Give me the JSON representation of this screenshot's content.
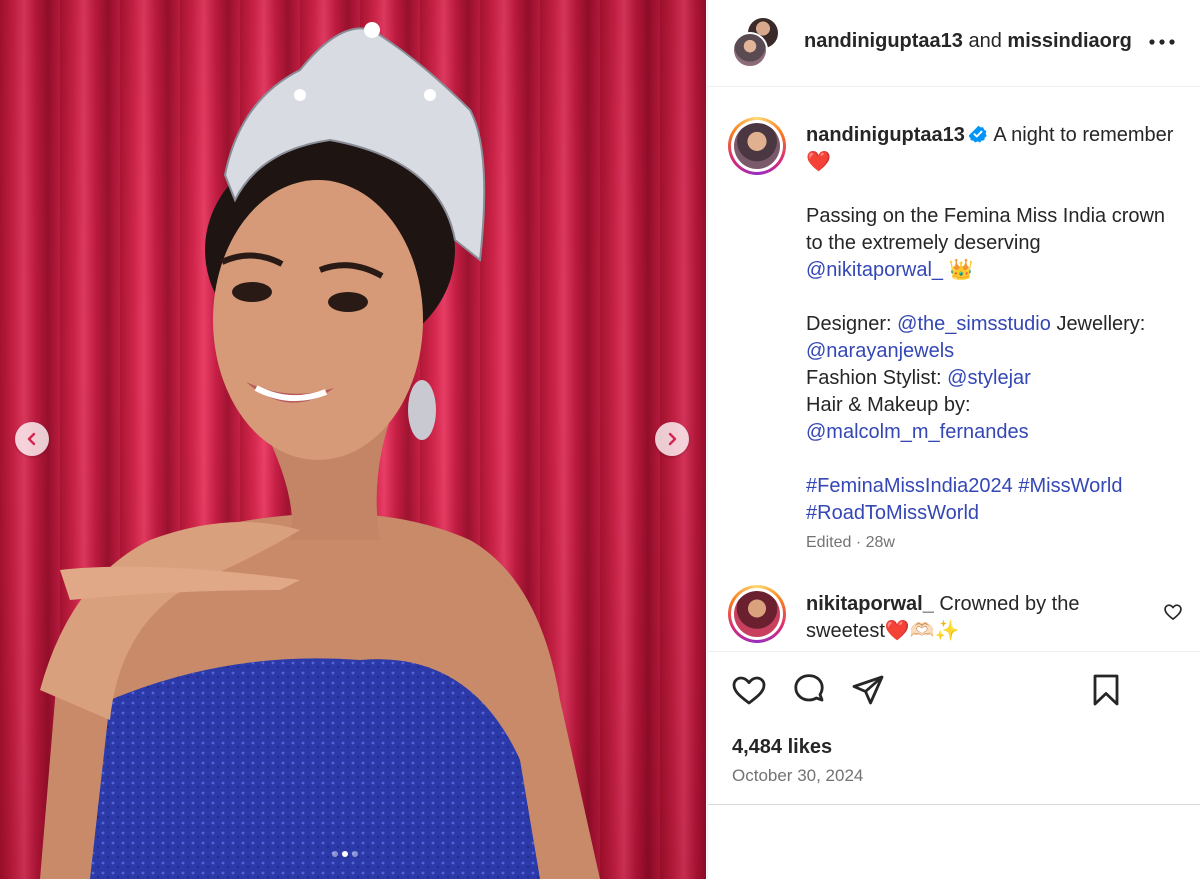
{
  "header": {
    "user1": "nandiniguptaa13",
    "and_text": "and",
    "user2": "missindiaorg",
    "more_icon": "more-horizontal-icon"
  },
  "caption": {
    "username": "nandiniguptaa13",
    "verified_icon": "verified-badge-icon",
    "line1": "A night to remember ❤️",
    "p2_text": "Passing on the Femina Miss India crown to the extremely deserving",
    "p2_mention": "@nikitaporwal_",
    "p2_emoji": "👑",
    "designer_label": "Designer:",
    "designer_mention": "@the_simsstudio",
    "jewellery_label": "Jewellery:",
    "jewellery_mention": "@narayanjewels",
    "stylist_label": "Fashion Stylist:",
    "stylist_mention": "@stylejar",
    "hair_label": "Hair & Makeup by:",
    "hair_mention": "@malcolm_m_fernandes",
    "hashtag1": "#FeminaMissIndia2024",
    "hashtag2": "#MissWorld",
    "hashtag3": "#RoadToMissWorld",
    "meta": "Edited · 28w"
  },
  "comment": {
    "username": "nikitaporwal_",
    "text": "Crowned by the sweetest❤️🫶🏻✨"
  },
  "actions": {
    "like_icon": "heart-icon",
    "comment_icon": "comment-icon",
    "share_icon": "send-icon",
    "save_icon": "bookmark-icon"
  },
  "likes": "4,484 likes",
  "date": "October 30, 2024",
  "carousel": {
    "total_slides": 3,
    "active_slide": 2,
    "prev_icon": "chevron-left-icon",
    "next_icon": "chevron-right-icon"
  },
  "colors": {
    "link": "#3447b5",
    "muted": "#737373",
    "text": "#262626",
    "verified": "#0095f6",
    "curtain": "#d8224a"
  }
}
